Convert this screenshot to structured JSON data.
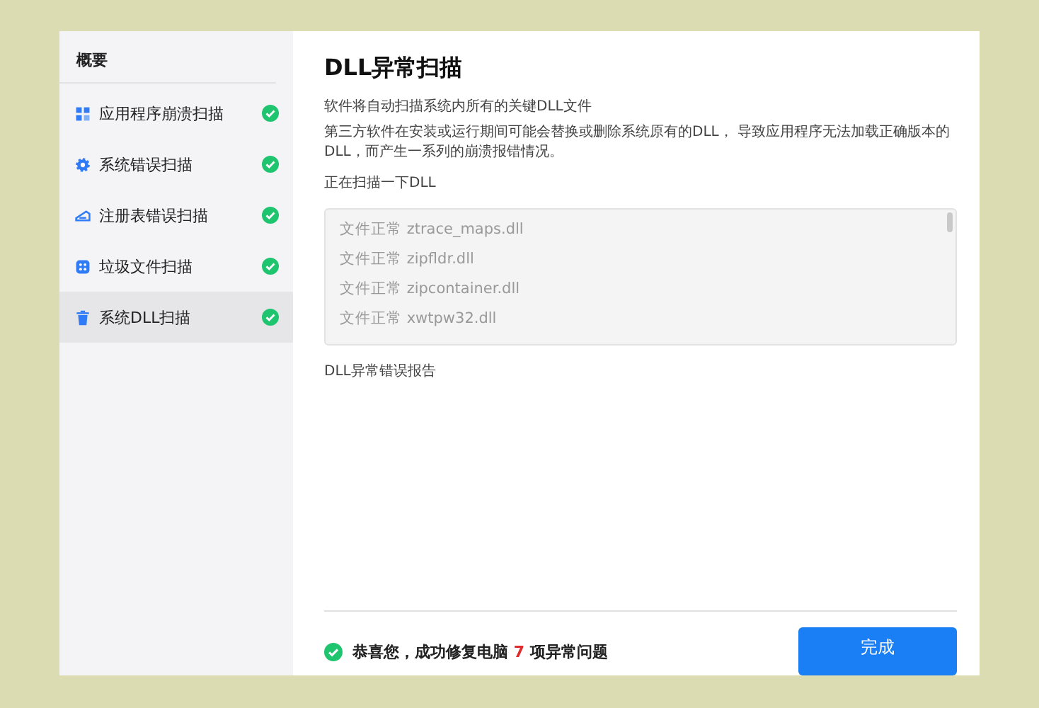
{
  "sidebar": {
    "heading": "概要",
    "items": [
      {
        "label": "应用程序崩溃扫描",
        "kind": "apps",
        "done": true,
        "selected": false
      },
      {
        "label": "系统错误扫描",
        "kind": "gear",
        "done": true,
        "selected": false
      },
      {
        "label": "注册表错误扫描",
        "kind": "registry",
        "done": true,
        "selected": false
      },
      {
        "label": "垃圾文件扫描",
        "kind": "junk",
        "done": true,
        "selected": false
      },
      {
        "label": "系统DLL扫描",
        "kind": "trash",
        "done": true,
        "selected": true
      }
    ]
  },
  "main": {
    "title": "DLL异常扫描",
    "intro": "软件将自动扫描系统内所有的关键DLL文件",
    "description": "第三方软件在安装或运行期间可能会替换或删除系统原有的DLL， 导致应用程序无法加载正确版本的DLL，而产生一系列的崩溃报错情况。",
    "scan_label": "正在扫描一下DLL",
    "scan_log": [
      {
        "status": "文件正常",
        "file": "ztrace_maps.dll"
      },
      {
        "status": "文件正常",
        "file": "zipfldr.dll"
      },
      {
        "status": "文件正常",
        "file": "zipcontainer.dll"
      },
      {
        "status": "文件正常",
        "file": "xwtpw32.dll"
      }
    ],
    "report_label": "DLL异常错误报告"
  },
  "footer": {
    "message_prefix": "恭喜您，成功修复电脑",
    "count": "7",
    "message_suffix": "项异常问题",
    "button": "完成"
  }
}
